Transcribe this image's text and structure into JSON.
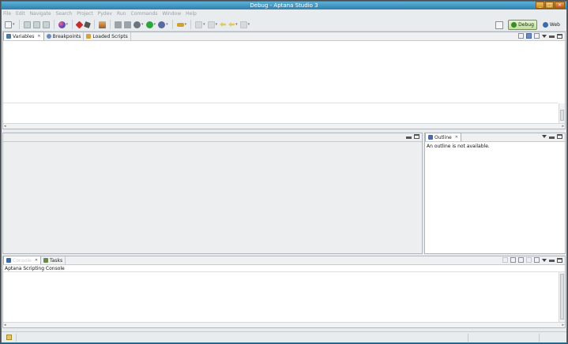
{
  "window": {
    "title": "Debug - Aptana Studio 3"
  },
  "window_buttons": [
    "_",
    "□",
    "×"
  ],
  "menu": [
    "File",
    "Edit",
    "Navigate",
    "Search",
    "Project",
    "Pydev",
    "Run",
    "Commands",
    "Window",
    "Help"
  ],
  "perspectives": {
    "debug_label": "Debug",
    "web_label": "Web"
  },
  "top_panel": {
    "tabs": [
      {
        "label": "Variables",
        "active": true,
        "closable": true
      },
      {
        "label": "Breakpoints",
        "active": false
      },
      {
        "label": "Loaded Scripts",
        "active": false
      }
    ]
  },
  "outline_panel": {
    "tab_label": "Outline",
    "message": "An outline is not available."
  },
  "console_panel": {
    "tabs": [
      {
        "label": "Console",
        "active": true,
        "closable": true
      },
      {
        "label": "Tasks",
        "active": false
      }
    ],
    "console_title": "Aptana Scripting Console"
  },
  "glyphs": {
    "close": "✕",
    "scroll_left": "◂",
    "scroll_right": "▸",
    "dropdown": "▾"
  },
  "colors": {
    "title_bar": "#2f7fae",
    "active_perspective": "#bfe09a",
    "panel_border": "#b0b6bc",
    "background": "#e9ecef"
  }
}
